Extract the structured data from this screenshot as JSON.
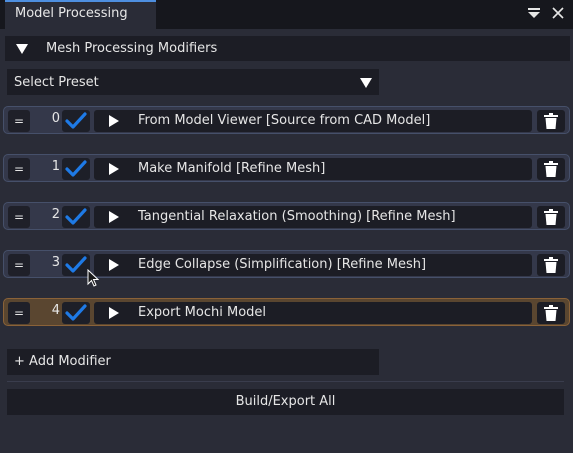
{
  "window": {
    "tab_title": "Model Processing",
    "tools": [
      {
        "icon": "dropdown-menu-icon"
      },
      {
        "icon": "close-icon"
      }
    ]
  },
  "section": {
    "title": "Mesh Processing Modifiers",
    "expanded": true
  },
  "preset": {
    "label": "Select Preset"
  },
  "modifiers": [
    {
      "index": "0",
      "enabled": true,
      "label": "From Model Viewer [Source from CAD Model]"
    },
    {
      "index": "1",
      "enabled": true,
      "label": "Make Manifold [Refine Mesh]"
    },
    {
      "index": "2",
      "enabled": true,
      "label": "Tangential Relaxation (Smoothing) [Refine Mesh]"
    },
    {
      "index": "3",
      "enabled": true,
      "label": "Edge Collapse (Simplification) [Refine Mesh]"
    },
    {
      "index": "4",
      "enabled": true,
      "label": "Export Mochi Model",
      "highlighted": true
    }
  ],
  "drag_handle_label": "=",
  "add_modifier_label": "+ Add Modifier",
  "build_label": "Build/Export All",
  "colors": {
    "accent": "#1e7ae6",
    "tab_highlight": "#4e8fe0",
    "active_row": "#8a6238"
  }
}
